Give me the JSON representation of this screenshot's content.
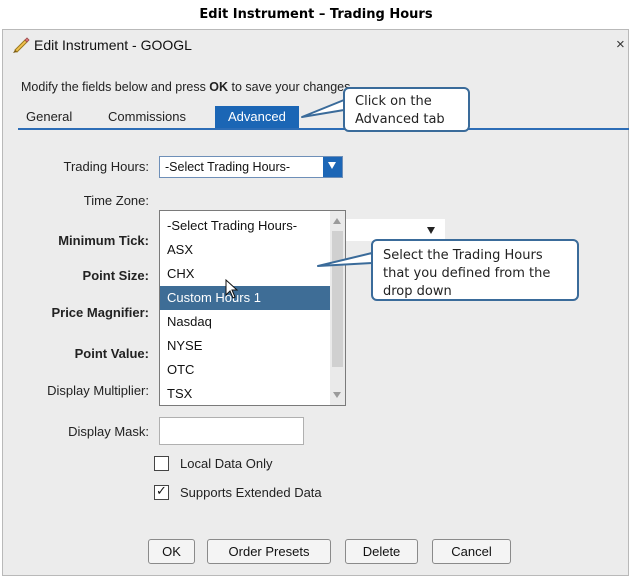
{
  "doc_title": "Edit Instrument – Trading Hours",
  "window": {
    "title": "Edit Instrument - GOOGL",
    "close_label": "×"
  },
  "instruction": {
    "prefix": "Modify the fields below and press ",
    "bold": "OK",
    "suffix": " to save your changes."
  },
  "tabs": [
    {
      "label": "General",
      "active": false
    },
    {
      "label": "Commissions",
      "active": false
    },
    {
      "label": "Advanced",
      "active": true
    }
  ],
  "labels": {
    "trading_hours": "Trading Hours:",
    "time_zone": "Time Zone:",
    "minimum_tick": "Minimum Tick:",
    "point_size": "Point Size:",
    "price_magnifier": "Price Magnifier:",
    "point_value": "Point Value:",
    "display_multiplier": "Display Multiplier:",
    "display_mask": "Display Mask:"
  },
  "trading_hours_select": {
    "value": "-Select Trading Hours-"
  },
  "trading_hours_options": [
    {
      "label": "-Select Trading Hours-",
      "selected": false
    },
    {
      "label": "ASX",
      "selected": false
    },
    {
      "label": "CHX",
      "selected": false
    },
    {
      "label": "Custom Hours 1",
      "selected": true
    },
    {
      "label": "Nasdaq",
      "selected": false
    },
    {
      "label": "NYSE",
      "selected": false
    },
    {
      "label": "OTC",
      "selected": false
    },
    {
      "label": "TSX",
      "selected": false
    }
  ],
  "checkboxes": {
    "local_data_only": {
      "label": "Local Data Only",
      "checked": false
    },
    "supports_extended_data": {
      "label": "Supports Extended Data",
      "checked": true,
      "mark": "✓"
    }
  },
  "buttons": {
    "ok": "OK",
    "order_presets": "Order Presets",
    "delete": "Delete",
    "cancel": "Cancel"
  },
  "callouts": {
    "advanced_tab": "Click on the Advanced tab",
    "select_hours": "Select the Trading Hours that you defined from the drop down"
  },
  "colors": {
    "accent": "#1b66b5",
    "selected_row": "#3e6d96",
    "callout_border": "#3a6b9a"
  }
}
